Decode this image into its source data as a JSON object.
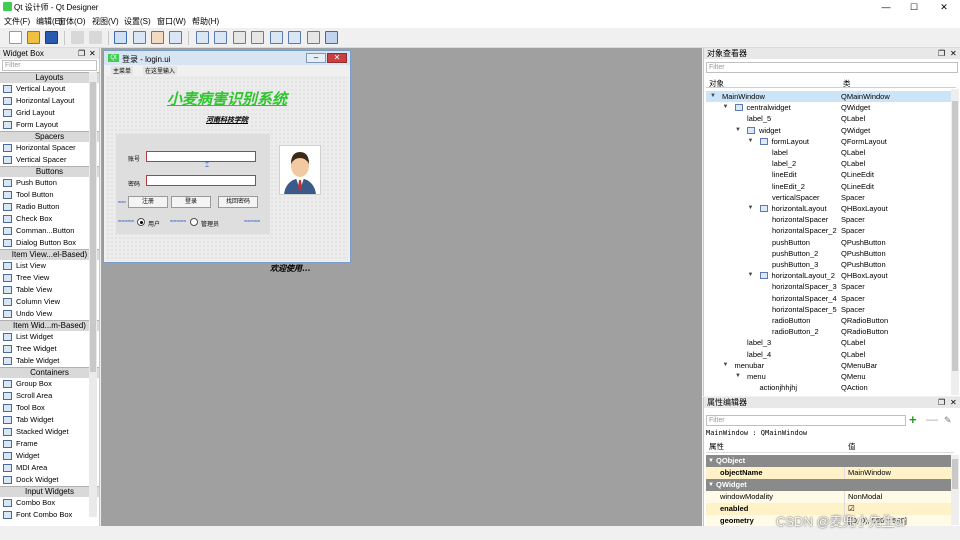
{
  "window": {
    "title": "Qt 设计师 - Qt Designer",
    "minimize": "—",
    "maximize": "☐",
    "close": "✕"
  },
  "menubar": [
    "文件(F)",
    "编辑(E)",
    "窗体(O)",
    "视图(V)",
    "设置(S)",
    "窗口(W)",
    "帮助(H)"
  ],
  "widget_box": {
    "title": "Widget Box",
    "filter_placeholder": "Filter",
    "categories": [
      {
        "name": "Layouts",
        "items": [
          "Vertical Layout",
          "Horizontal Layout",
          "Grid Layout",
          "Form Layout"
        ]
      },
      {
        "name": "Spacers",
        "items": [
          "Horizontal Spacer",
          "Vertical Spacer"
        ]
      },
      {
        "name": "Buttons",
        "items": [
          "Push Button",
          "Tool Button",
          "Radio Button",
          "Check Box",
          "Comman...Button",
          "Dialog Button Box"
        ]
      },
      {
        "name": "Item View...el-Based)",
        "items": [
          "List View",
          "Tree View",
          "Table View",
          "Column View",
          "Undo View"
        ]
      },
      {
        "name": "Item Wid...m-Based)",
        "items": [
          "List Widget",
          "Tree Widget",
          "Table Widget"
        ]
      },
      {
        "name": "Containers",
        "items": [
          "Group Box",
          "Scroll Area",
          "Tool Box",
          "Tab Widget",
          "Stacked Widget",
          "Frame",
          "Widget",
          "MDI Area",
          "Dock Widget"
        ]
      },
      {
        "name": "Input Widgets",
        "items": [
          "Combo Box",
          "Font Combo Box"
        ]
      }
    ]
  },
  "form": {
    "title": "登录 - login.ui",
    "qt_badge": "Qt",
    "menu": [
      "主菜单",
      "在这里输入"
    ],
    "app_title": "小麦病害识别系统",
    "school": "河南科技学院",
    "account_label": "账号",
    "password_label": "密码",
    "buttons": [
      "注册",
      "登录",
      "找回密码"
    ],
    "radio_user": "用户",
    "radio_admin": "管理员",
    "welcome": "欢迎使用..."
  },
  "object_inspector": {
    "title": "对象查看器",
    "filter_placeholder": "Filter",
    "col_object": "对象",
    "col_class": "类",
    "rows": [
      {
        "obj": "MainWindow",
        "cls": "QMainWindow"
      },
      {
        "obj": "centralwidget",
        "cls": "QWidget"
      },
      {
        "obj": "label_5",
        "cls": "QLabel"
      },
      {
        "obj": "widget",
        "cls": "QWidget"
      },
      {
        "obj": "formLayout",
        "cls": "QFormLayout"
      },
      {
        "obj": "label",
        "cls": "QLabel"
      },
      {
        "obj": "label_2",
        "cls": "QLabel"
      },
      {
        "obj": "lineEdit",
        "cls": "QLineEdit"
      },
      {
        "obj": "lineEdit_2",
        "cls": "QLineEdit"
      },
      {
        "obj": "verticalSpacer",
        "cls": "Spacer"
      },
      {
        "obj": "horizontalLayout",
        "cls": "QHBoxLayout"
      },
      {
        "obj": "horizontalSpacer",
        "cls": "Spacer"
      },
      {
        "obj": "horizontalSpacer_2",
        "cls": "Spacer"
      },
      {
        "obj": "pushButton",
        "cls": "QPushButton"
      },
      {
        "obj": "pushButton_2",
        "cls": "QPushButton"
      },
      {
        "obj": "pushButton_3",
        "cls": "QPushButton"
      },
      {
        "obj": "horizontalLayout_2",
        "cls": "QHBoxLayout"
      },
      {
        "obj": "horizontalSpacer_3",
        "cls": "Spacer"
      },
      {
        "obj": "horizontalSpacer_4",
        "cls": "Spacer"
      },
      {
        "obj": "horizontalSpacer_5",
        "cls": "Spacer"
      },
      {
        "obj": "radioButton",
        "cls": "QRadioButton"
      },
      {
        "obj": "radioButton_2",
        "cls": "QRadioButton"
      },
      {
        "obj": "label_3",
        "cls": "QLabel"
      },
      {
        "obj": "label_4",
        "cls": "QLabel"
      },
      {
        "obj": "menubar",
        "cls": "QMenuBar"
      },
      {
        "obj": "menu",
        "cls": "QMenu"
      },
      {
        "obj": "actionjhhjhj",
        "cls": "QAction"
      }
    ]
  },
  "property_editor": {
    "title": "属性编辑器",
    "filter_placeholder": "Filter",
    "object_line": "MainWindow : QMainWindow",
    "col_property": "属性",
    "col_value": "值",
    "rows": [
      {
        "type": "group",
        "name": "QObject",
        "value": ""
      },
      {
        "type": "prop",
        "name": "objectName",
        "value": "MainWindow",
        "style": "y1",
        "bold": true
      },
      {
        "type": "group",
        "name": "QWidget",
        "value": ""
      },
      {
        "type": "prop",
        "name": "windowModality",
        "value": "NonModal",
        "style": "y2",
        "bold": false
      },
      {
        "type": "prop",
        "name": "enabled",
        "value": "☑",
        "style": "y1",
        "bold": true
      },
      {
        "type": "prop",
        "name": "geometry",
        "value": "[(0, 0), 960 x 540]",
        "style": "y2",
        "bold": true
      }
    ]
  },
  "watermark": "CSDN @麦兜小先生er",
  "colors": {
    "app_title": "#2ec52e",
    "selection": "#cce4f7",
    "group_header": "#8a8a8a"
  }
}
